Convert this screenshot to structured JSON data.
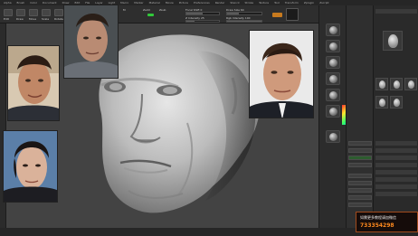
{
  "menu": {
    "items": [
      "Alpha",
      "Brush",
      "Color",
      "Document",
      "Draw",
      "Edit",
      "File",
      "Layer",
      "Light",
      "Macro",
      "Marker",
      "Material",
      "Movie",
      "Picture",
      "Preferences",
      "Render",
      "Stencil",
      "Stroke",
      "Texture",
      "Tool",
      "Transform",
      "Zplugin",
      "Zscript"
    ]
  },
  "shelf": {
    "edit_label": "Edit",
    "draw_label": "Draw",
    "move_label": "Move",
    "scale_label": "Scale",
    "rotate_label": "Rotate",
    "mrgb_label": "Mrgb",
    "rgb_label": "Rgb",
    "m_label": "M",
    "zadd_label": "Zadd",
    "zsub_label": "Zsub",
    "focal_label": "Focal Shift 0",
    "draw_size_label": "Draw Size 64",
    "z_intensity_label": "Z Intensity 25",
    "rgb_intensity_label": "Rgb Intensity 100"
  },
  "watermark": {
    "line1": "如需更多教程请加微信",
    "line2": "733354298"
  },
  "colors": {
    "accent_green": "#31c93a",
    "accent_orange": "#c77a1e",
    "watermark_text": "#ff8a1e",
    "canvas_bg": "#434343"
  },
  "icons": [
    "sphere-brush-icon",
    "standard-brush-icon",
    "clay-brush-icon",
    "move-brush-icon",
    "smooth-brush-icon",
    "dam-standard-brush-icon",
    "color-picker-icon",
    "material-icon"
  ],
  "photos": [
    "reference-photo-1",
    "reference-photo-2",
    "reference-photo-3",
    "reference-photo-4"
  ]
}
